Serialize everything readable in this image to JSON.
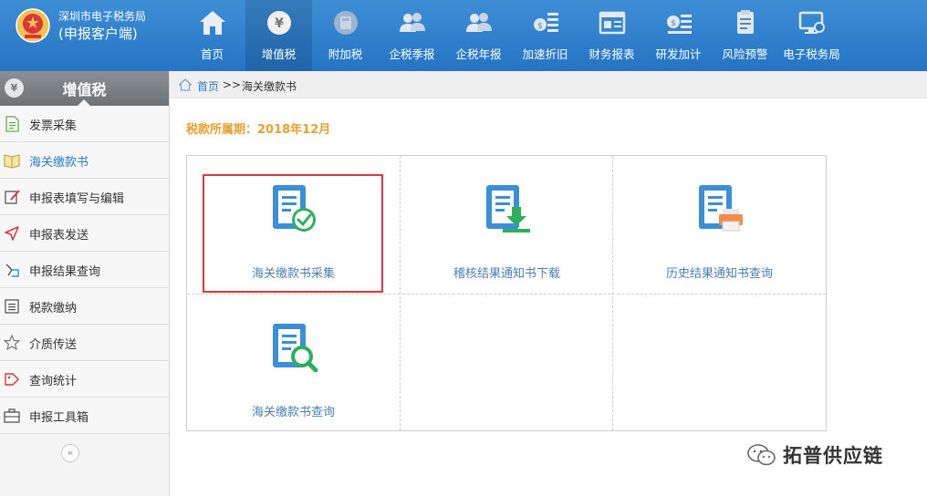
{
  "app": {
    "org_name": "深圳市电子税务局",
    "client_name": "(申报客户端)"
  },
  "nav": [
    {
      "label": "首页",
      "icon": "home-icon",
      "active": false
    },
    {
      "label": "增值税",
      "icon": "yen-coin-icon",
      "active": true
    },
    {
      "label": "附加税",
      "icon": "calculator-icon",
      "active": false
    },
    {
      "label": "企税季报",
      "icon": "users-icon",
      "active": false
    },
    {
      "label": "企税年报",
      "icon": "users-icon",
      "active": false
    },
    {
      "label": "加速折旧",
      "icon": "coin-list-icon",
      "active": false
    },
    {
      "label": "财务报表",
      "icon": "report-icon",
      "active": false
    },
    {
      "label": "研发加计",
      "icon": "coin-stack-icon",
      "active": false
    },
    {
      "label": "风险预警",
      "icon": "clipboard-icon",
      "active": false
    },
    {
      "label": "电子税务局",
      "icon": "monitor-icon",
      "active": false
    }
  ],
  "sidebar": {
    "badge": "¥",
    "title": "增值税",
    "items": [
      {
        "label": "发票采集",
        "icon": "document-icon",
        "active": false
      },
      {
        "label": "海关缴款书",
        "icon": "book-icon",
        "active": true
      },
      {
        "label": "申报表填写与编辑",
        "icon": "edit-icon",
        "active": false
      },
      {
        "label": "申报表发送",
        "icon": "send-icon",
        "active": false
      },
      {
        "label": "申报结果查询",
        "icon": "result-query-icon",
        "active": false
      },
      {
        "label": "税款缴纳",
        "icon": "list-icon",
        "active": false
      },
      {
        "label": "介质传送",
        "icon": "star-icon",
        "active": false
      },
      {
        "label": "查询统计",
        "icon": "tag-icon",
        "active": false
      },
      {
        "label": "申报工具箱",
        "icon": "toolbox-icon",
        "active": false
      }
    ],
    "collapse_glyph": "«"
  },
  "breadcrumb": {
    "home": "首页",
    "separator": ">>",
    "current": "海关缴款书"
  },
  "period_label": "税款所属期：2018年12月",
  "cards": [
    {
      "label": "海关缴款书采集",
      "icon": "doc-check-icon",
      "highlighted": true
    },
    {
      "label": "稽核结果通知书下载",
      "icon": "doc-download-icon",
      "highlighted": false
    },
    {
      "label": "历史结果通知书查询",
      "icon": "doc-print-icon",
      "highlighted": false
    },
    {
      "label": "海关缴款书查询",
      "icon": "doc-search-icon",
      "highlighted": false
    }
  ],
  "watermark": "拓普供应链",
  "colors": {
    "header_blue": "#2a7ac9",
    "link_blue": "#2b7cc4",
    "period_orange": "#e8a030",
    "highlight_red": "#d9363e",
    "icon_blue": "#3a8fd6",
    "icon_green": "#2eaf5e"
  }
}
